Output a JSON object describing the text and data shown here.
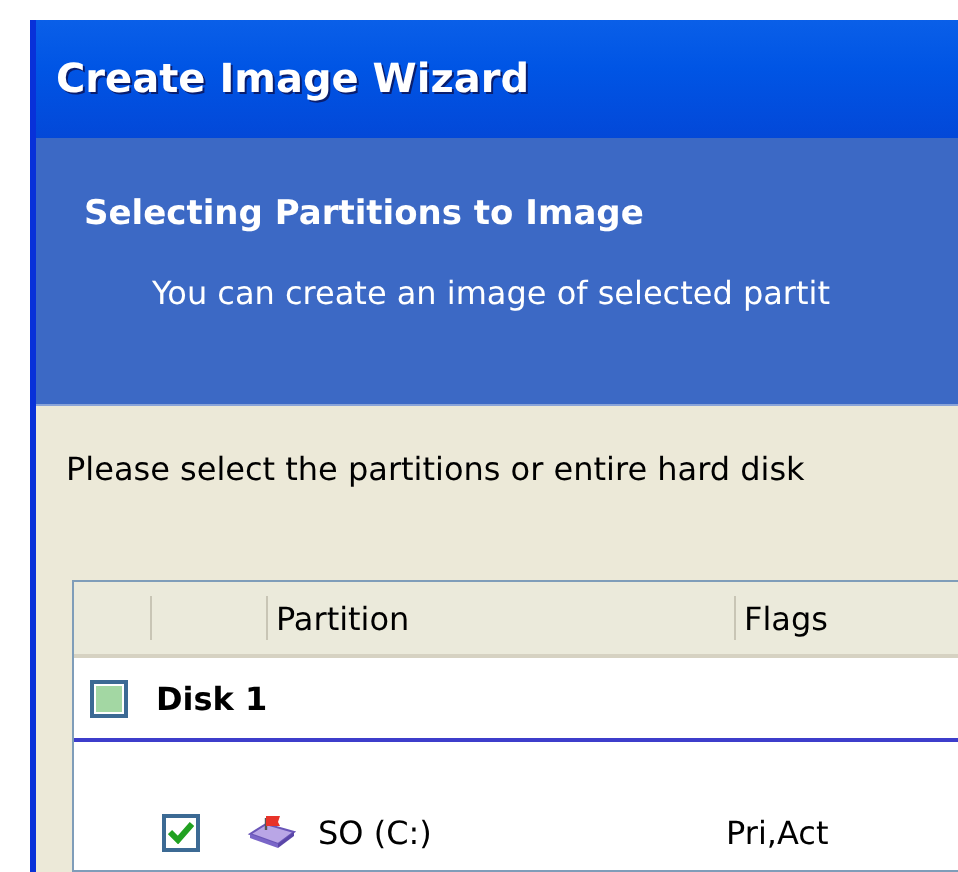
{
  "window": {
    "title": "Create Image Wizard"
  },
  "header": {
    "title": "Selecting Partitions to Image",
    "subtitle": "You can create an image of selected partit"
  },
  "instruction": "Please select the partitions or entire hard disk",
  "table": {
    "columns": [
      "Partition",
      "Flags"
    ],
    "disks": [
      {
        "name": "Disk 1",
        "checked": false,
        "partial": true,
        "partitions": [
          {
            "name": "SO (C:)",
            "flags": "Pri,Act",
            "checked": true
          }
        ]
      }
    ]
  }
}
